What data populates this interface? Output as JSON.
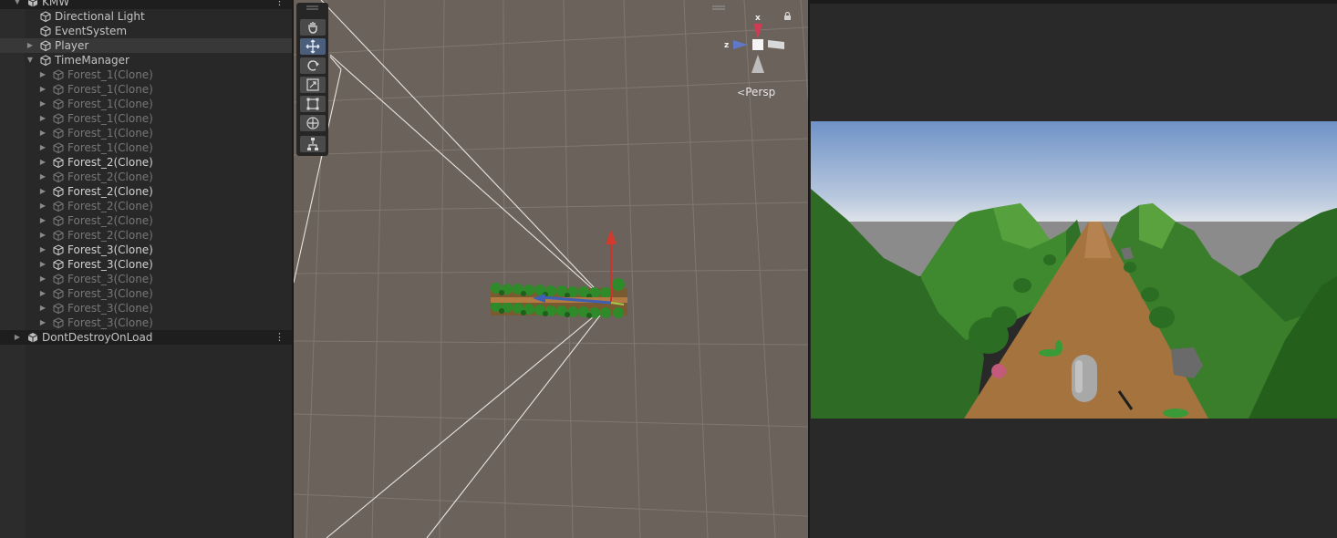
{
  "hierarchy": {
    "scene_name": "KMW",
    "dont_destroy": "DontDestroyOnLoad",
    "items": [
      {
        "label": "Directional Light",
        "depth": 1,
        "state": "normal",
        "arrow": ""
      },
      {
        "label": "EventSystem",
        "depth": 1,
        "state": "normal",
        "arrow": ""
      },
      {
        "label": "Player",
        "depth": 1,
        "state": "selected",
        "arrow": "collapsed"
      },
      {
        "label": "TimeManager",
        "depth": 1,
        "state": "normal",
        "arrow": "expanded"
      },
      {
        "label": "Forest_1(Clone)",
        "depth": 2,
        "state": "inactive",
        "arrow": "collapsed"
      },
      {
        "label": "Forest_1(Clone)",
        "depth": 2,
        "state": "inactive",
        "arrow": "collapsed"
      },
      {
        "label": "Forest_1(Clone)",
        "depth": 2,
        "state": "inactive",
        "arrow": "collapsed"
      },
      {
        "label": "Forest_1(Clone)",
        "depth": 2,
        "state": "inactive",
        "arrow": "collapsed"
      },
      {
        "label": "Forest_1(Clone)",
        "depth": 2,
        "state": "inactive",
        "arrow": "collapsed"
      },
      {
        "label": "Forest_1(Clone)",
        "depth": 2,
        "state": "inactive",
        "arrow": "collapsed"
      },
      {
        "label": "Forest_2(Clone)",
        "depth": 2,
        "state": "active",
        "arrow": "collapsed"
      },
      {
        "label": "Forest_2(Clone)",
        "depth": 2,
        "state": "inactive",
        "arrow": "collapsed"
      },
      {
        "label": "Forest_2(Clone)",
        "depth": 2,
        "state": "active",
        "arrow": "collapsed"
      },
      {
        "label": "Forest_2(Clone)",
        "depth": 2,
        "state": "inactive",
        "arrow": "collapsed"
      },
      {
        "label": "Forest_2(Clone)",
        "depth": 2,
        "state": "inactive",
        "arrow": "collapsed"
      },
      {
        "label": "Forest_2(Clone)",
        "depth": 2,
        "state": "inactive",
        "arrow": "collapsed"
      },
      {
        "label": "Forest_3(Clone)",
        "depth": 2,
        "state": "active",
        "arrow": "collapsed"
      },
      {
        "label": "Forest_3(Clone)",
        "depth": 2,
        "state": "active",
        "arrow": "collapsed"
      },
      {
        "label": "Forest_3(Clone)",
        "depth": 2,
        "state": "inactive",
        "arrow": "collapsed"
      },
      {
        "label": "Forest_3(Clone)",
        "depth": 2,
        "state": "inactive",
        "arrow": "collapsed"
      },
      {
        "label": "Forest_3(Clone)",
        "depth": 2,
        "state": "inactive",
        "arrow": "collapsed"
      },
      {
        "label": "Forest_3(Clone)",
        "depth": 2,
        "state": "inactive",
        "arrow": "collapsed"
      }
    ]
  },
  "scene_view": {
    "persp_label": "Persp",
    "axis_x": "x",
    "axis_z": "z",
    "tools": [
      "hand-icon",
      "move-icon",
      "rotate-icon",
      "scale-icon",
      "rect-tool-icon",
      "transform-icon",
      "custom-tool-icon"
    ]
  },
  "colors": {
    "scene_bg": "#6b625c",
    "panel_bg": "#282828",
    "sky_top": "#6f93c7",
    "ground": "#3a7a2a",
    "path": "#a5743e"
  }
}
